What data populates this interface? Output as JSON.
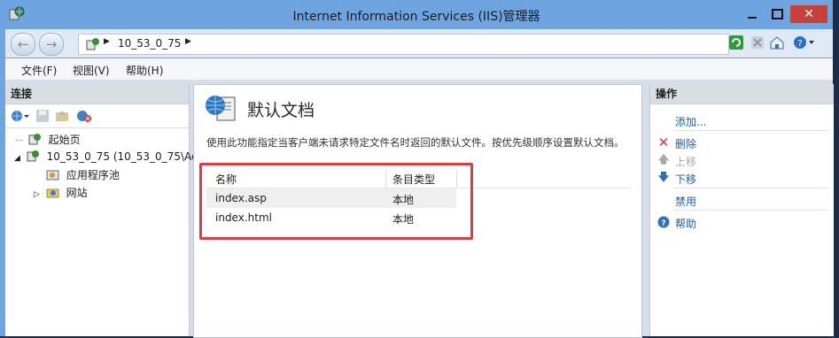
{
  "window": {
    "title": "Internet Information Services (IIS)管理器",
    "close_glyph": "✕"
  },
  "address": {
    "server": "10_53_0_75"
  },
  "menu": [
    {
      "label": "文件(F)"
    },
    {
      "label": "视图(V)"
    },
    {
      "label": "帮助(H)"
    }
  ],
  "connections": {
    "header": "连接",
    "tree": [
      {
        "label": "起始页",
        "icon": "start-page-icon"
      },
      {
        "label": "10_53_0_75 (10_53_0_75\\Ac",
        "icon": "server-icon"
      },
      {
        "label": "应用程序池",
        "icon": "app-pool-icon"
      },
      {
        "label": "网站",
        "icon": "sites-folder-icon"
      }
    ]
  },
  "feature": {
    "title": "默认文档",
    "description": "使用此功能指定当客户端未请求特定文件名时返回的默认文件。按优先级顺序设置默认文档。",
    "columns": [
      "名称",
      "条目类型"
    ],
    "rows": [
      {
        "name": "index.asp",
        "type": "本地"
      },
      {
        "name": "index.html",
        "type": "本地"
      }
    ]
  },
  "actions": {
    "header": "操作",
    "items": [
      {
        "label": "添加..."
      },
      {
        "label": "删除"
      },
      {
        "label": "上移"
      },
      {
        "label": "下移"
      },
      {
        "label": "禁用"
      },
      {
        "label": "帮助"
      }
    ]
  },
  "colors": {
    "highlight_box": "#e23b3b",
    "link": "#1f5fa6",
    "title_bar": "#6ea5e0"
  }
}
